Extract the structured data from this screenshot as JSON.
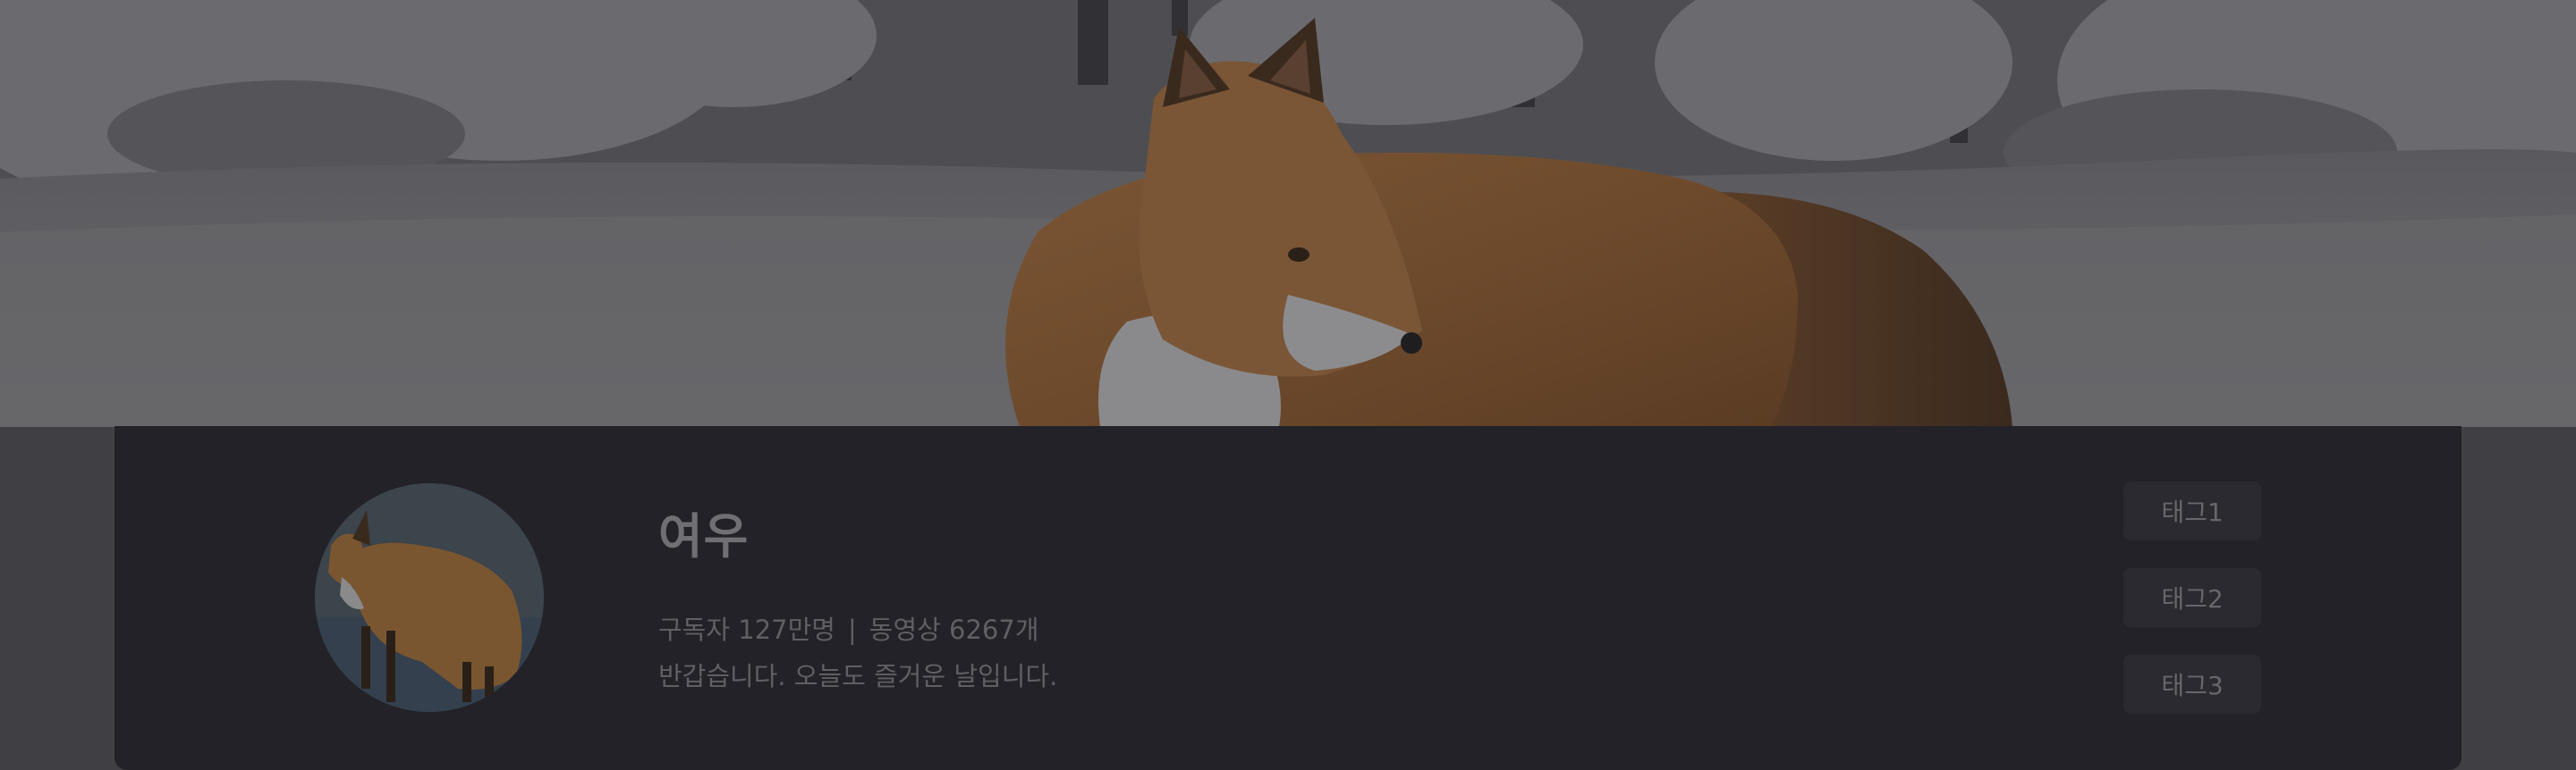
{
  "banner": {
    "image": "snowy-forest-fox-banner"
  },
  "profile": {
    "avatar_image": "fox-avatar",
    "name": "여우",
    "subscribers": "구독자 127만명",
    "separator": "|",
    "videos": "동영상 6267개",
    "greeting": "반갑습니다. 오늘도 즐거운 날입니다."
  },
  "tags": [
    {
      "label": "태그1"
    },
    {
      "label": "태그2"
    },
    {
      "label": "태그3"
    }
  ],
  "colors": {
    "card_background": "#222228",
    "page_background": "#404044",
    "tag_background": "#2a2a30",
    "text_muted": "#5f5f64"
  }
}
